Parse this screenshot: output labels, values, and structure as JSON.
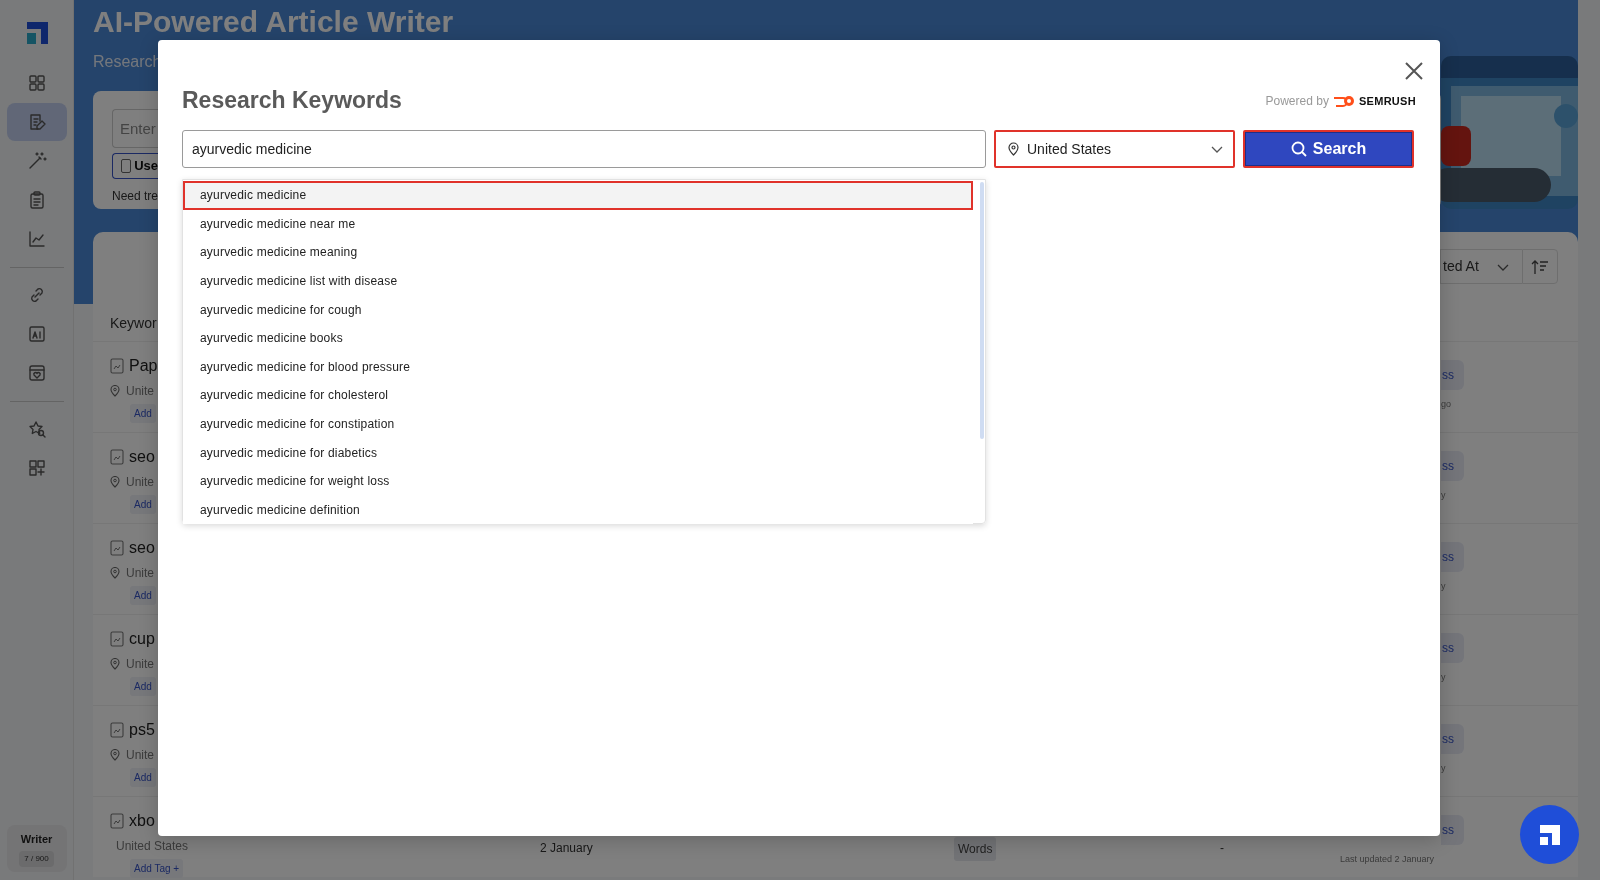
{
  "sidebar": {
    "groups": [
      {
        "items": [
          {
            "selected": false
          },
          {
            "selected": true
          },
          {
            "selected": false
          },
          {
            "selected": false
          },
          {
            "selected": false
          }
        ]
      },
      {
        "items": [
          {
            "selected": false
          },
          {
            "selected": false
          },
          {
            "selected": false
          }
        ]
      },
      {
        "items": [
          {
            "selected": false
          },
          {
            "selected": false
          }
        ]
      }
    ],
    "plan": {
      "label": "Writer",
      "usage": "7 / 900"
    }
  },
  "page": {
    "title": "AI-Powered Article Writer",
    "subtitle": "Research",
    "keyword_input": {
      "placeholder": "Enter"
    },
    "use_option": {
      "label": "Use",
      "checked": false
    },
    "hint": "Need tre",
    "sort": {
      "label": "ted At"
    },
    "list_header": "Keywor",
    "rows": [
      {
        "name": "Pap",
        "location": "Unite",
        "tag": "Add",
        "status": "ss",
        "updated": "go"
      },
      {
        "name": "seo",
        "location": "Unite",
        "tag": "Add",
        "status": "ss",
        "updated": "y"
      },
      {
        "name": "seo",
        "location": "Unite",
        "tag": "Add",
        "status": "ss",
        "updated": "y"
      },
      {
        "name": "cup",
        "location": "Unite",
        "tag": "Add",
        "status": "ss",
        "updated": "y"
      },
      {
        "name": "ps5",
        "location": "Unite",
        "tag": "Add",
        "status": "ss",
        "updated": "y"
      },
      {
        "name": "xbo",
        "location": "United States",
        "tag": "Add Tag +",
        "date": "2 January",
        "words": "Words",
        "column_5": "-",
        "status": "ss",
        "updated": "Last updated 2 January"
      }
    ]
  },
  "modal": {
    "title": "Research Keywords",
    "powered_by": "Powered by",
    "brand": "SEMRUSH",
    "query": "ayurvedic medicine",
    "location": {
      "value": "United States",
      "highlighted": true
    },
    "search_button": {
      "label": "Search",
      "highlighted": true
    },
    "suggestions": [
      {
        "text": "ayurvedic medicine",
        "selected": true
      },
      {
        "text": "ayurvedic medicine near me",
        "selected": false
      },
      {
        "text": "ayurvedic medicine meaning",
        "selected": false
      },
      {
        "text": "ayurvedic medicine list with disease",
        "selected": false
      },
      {
        "text": "ayurvedic medicine for cough",
        "selected": false
      },
      {
        "text": "ayurvedic medicine books",
        "selected": false
      },
      {
        "text": "ayurvedic medicine for blood pressure",
        "selected": false
      },
      {
        "text": "ayurvedic medicine for cholesterol",
        "selected": false
      },
      {
        "text": "ayurvedic medicine for constipation",
        "selected": false
      },
      {
        "text": "ayurvedic medicine for diabetics",
        "selected": false
      },
      {
        "text": "ayurvedic medicine for weight loss",
        "selected": false
      },
      {
        "text": "ayurvedic medicine definition",
        "selected": false
      }
    ]
  }
}
